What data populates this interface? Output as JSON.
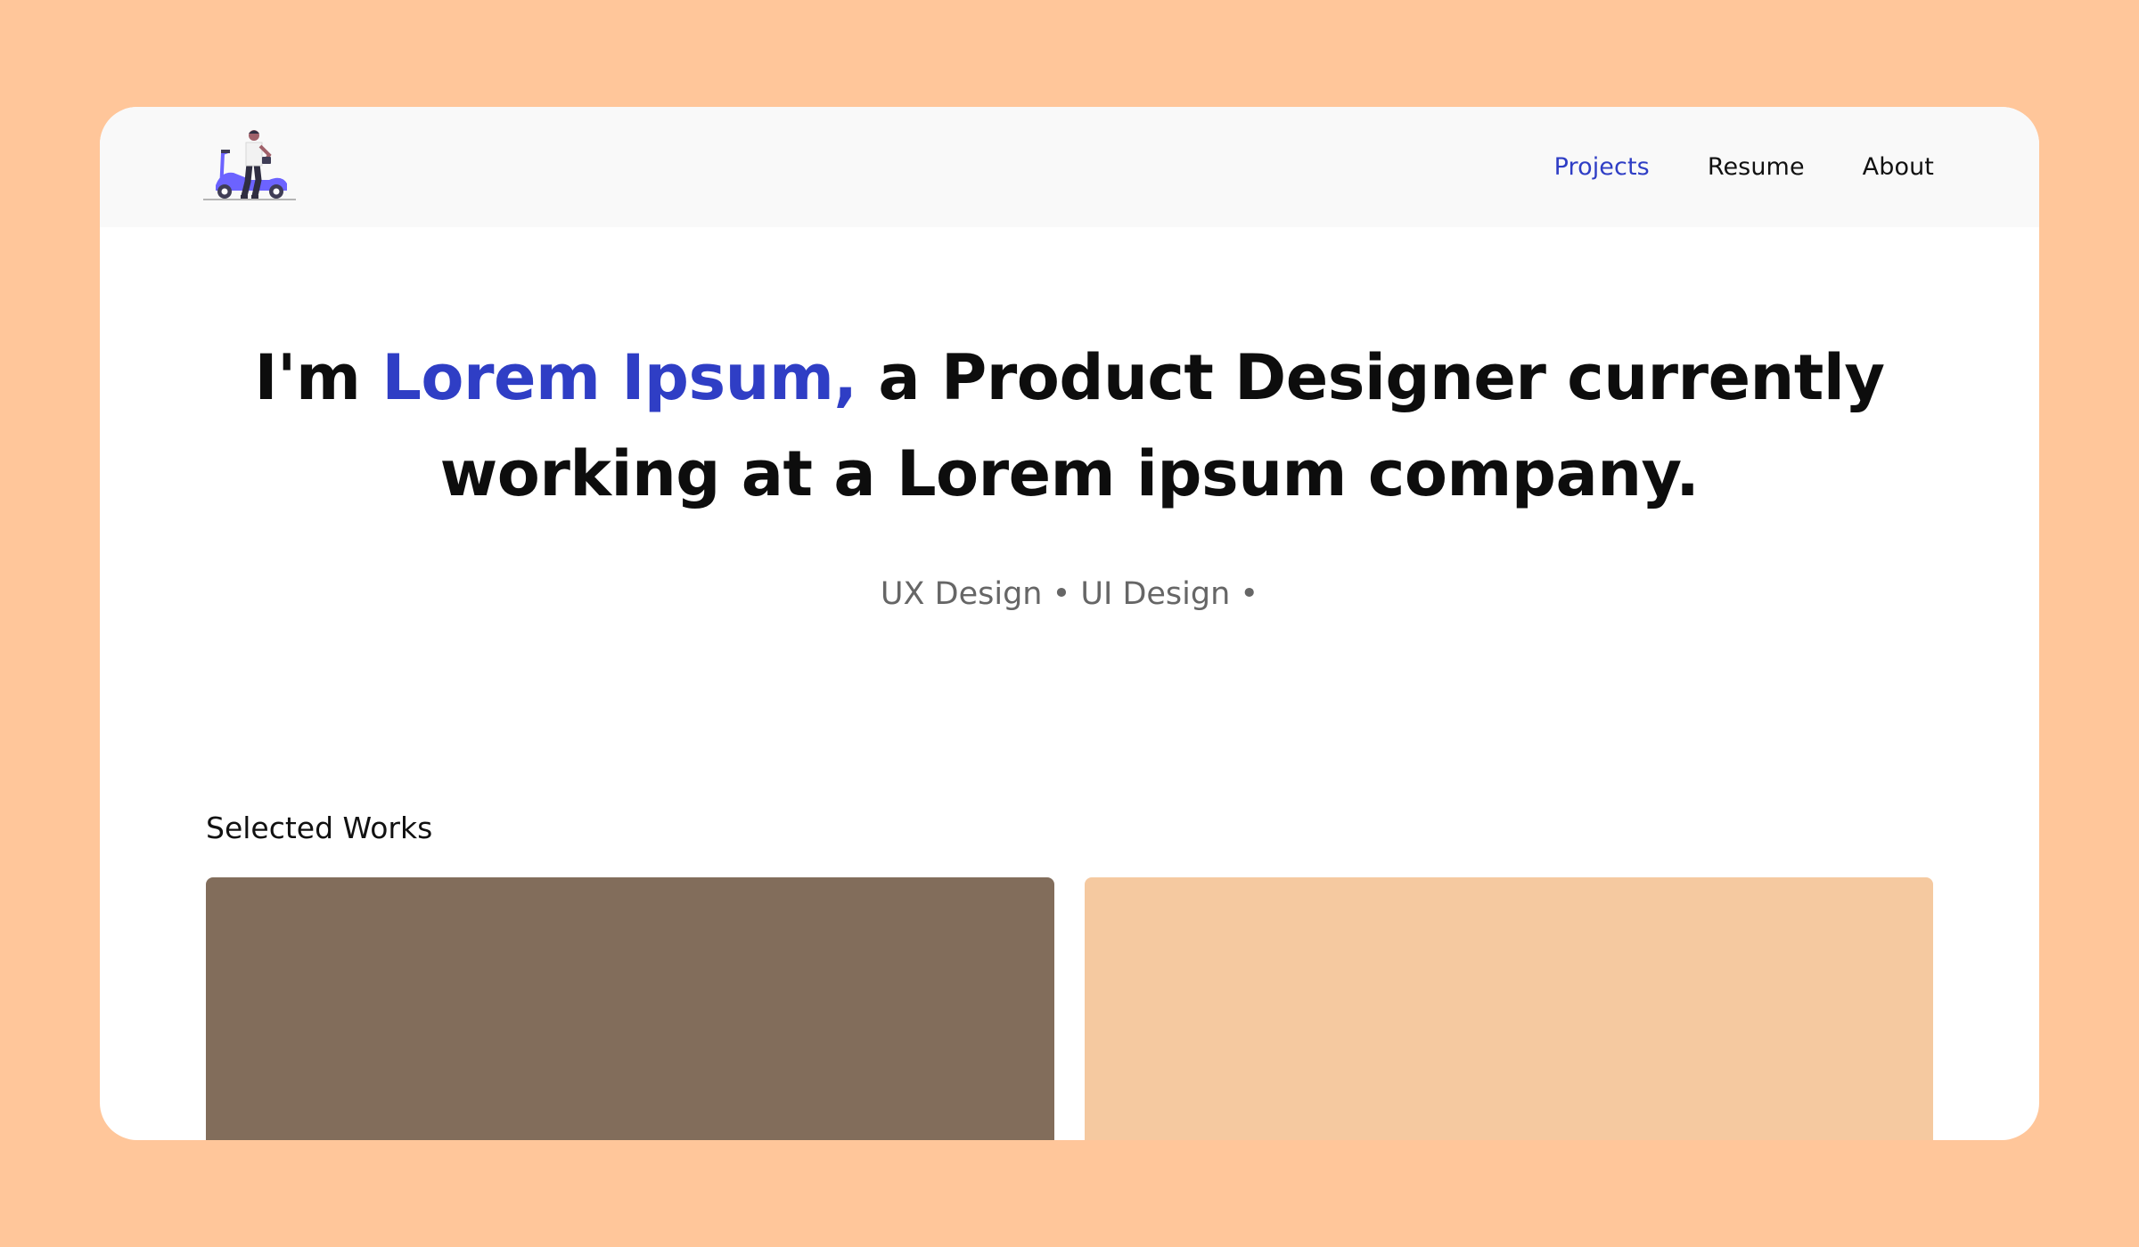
{
  "colors": {
    "background": "#ffc69a",
    "window": "#ffffff",
    "header": "#f9f9f9",
    "accent": "#2f3ec5",
    "card_brown": "#826d5b",
    "card_peach": "#f5c9a0"
  },
  "header": {
    "logo_icon": "person-on-scooter-icon",
    "nav": [
      {
        "label": "Projects",
        "active": true
      },
      {
        "label": "Resume",
        "active": false
      },
      {
        "label": "About",
        "active": false
      }
    ]
  },
  "hero": {
    "intro": "I'm ",
    "name": "Lorem Ipsum,",
    "rest": " a Product Designer currently working at a Lorem ipsum company.",
    "tags": "UX Design • UI Design •"
  },
  "works": {
    "title": "Selected Works",
    "cards": [
      {
        "color": "#826d5b"
      },
      {
        "color": "#f5c9a0"
      }
    ]
  }
}
